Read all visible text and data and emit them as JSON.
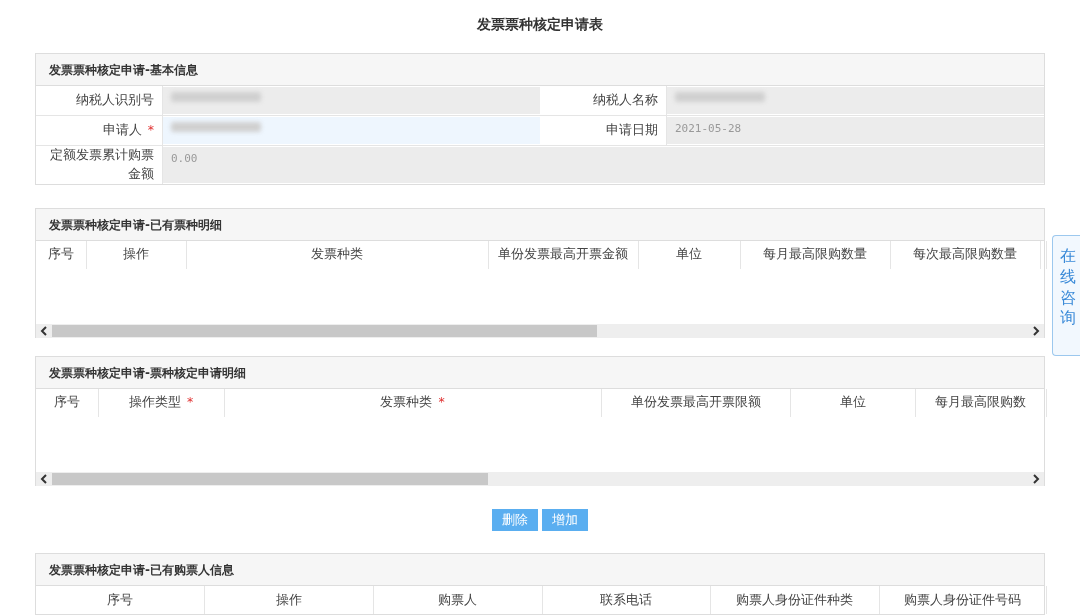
{
  "page_title": "发票票种核定申请表",
  "basic_info": {
    "title": "发票票种核定申请-基本信息",
    "rows": [
      [
        {
          "label": "纳税人识别号",
          "redacted": true,
          "editable": false
        },
        {
          "label": "纳税人名称",
          "redacted": true,
          "editable": false
        }
      ],
      [
        {
          "label": "申请人",
          "required_mark": "*",
          "redacted": true,
          "editable": true
        },
        {
          "label": "申请日期",
          "value": "2021-05-28",
          "editable": false
        }
      ],
      [
        {
          "label": "定额发票累计购票金额",
          "value": "0.00",
          "editable": false
        }
      ]
    ]
  },
  "tables": [
    {
      "title": "发票票种核定申请-已有票种明细",
      "columns": [
        {
          "label": "序号"
        },
        {
          "label": "操作"
        },
        {
          "label": "发票种类"
        },
        {
          "label": "单份发票最高开票金额"
        },
        {
          "label": "单位"
        },
        {
          "label": "每月最高限购数量"
        },
        {
          "label": "每次最高限购数量"
        }
      ]
    },
    {
      "title": "发票票种核定申请-票种核定申请明细",
      "columns": [
        {
          "label": "序号"
        },
        {
          "label": "操作类型",
          "required_mark": "*"
        },
        {
          "label": "发票种类",
          "required_mark": "*"
        },
        {
          "label": "单份发票最高开票限额"
        },
        {
          "label": "单位"
        },
        {
          "label": "每月最高限购数"
        }
      ],
      "buttons": [
        {
          "label": "删除"
        },
        {
          "label": "增加"
        }
      ]
    },
    {
      "title": "发票票种核定申请-已有购票人信息",
      "columns": [
        {
          "label": "序号"
        },
        {
          "label": "操作"
        },
        {
          "label": "购票人"
        },
        {
          "label": "联系电话"
        },
        {
          "label": "购票人身份证件种类"
        },
        {
          "label": "购票人身份证件号码"
        }
      ]
    }
  ],
  "side_tab": {
    "label": "在线咨询"
  }
}
